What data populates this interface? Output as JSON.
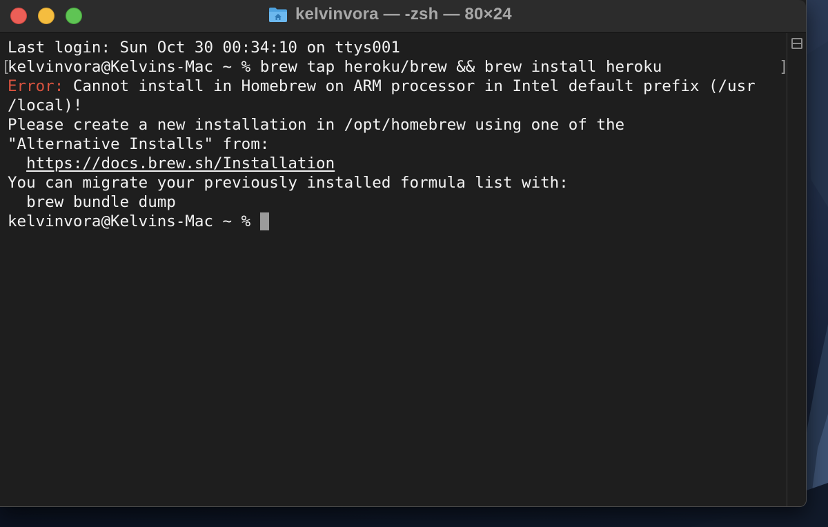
{
  "window": {
    "title": "kelvinvora — -zsh — 80×24",
    "title_icon": "home-folder-icon"
  },
  "terminal": {
    "lines": {
      "l0": "Last login: Sun Oct 30 00:34:10 on ttys001",
      "l1_prompt": "kelvinvora@Kelvins-Mac ~ % ",
      "l1_command": "brew tap heroku/brew && brew install heroku",
      "l2_error_label": "Error:",
      "l2_text": " Cannot install in Homebrew on ARM processor in Intel default prefix (/usr",
      "l3": "/local)!",
      "l4": "Please create a new installation in /opt/homebrew using one of the",
      "l5": "\"Alternative Installs\" from:",
      "l6_indent": "  ",
      "l6_link": "https://docs.brew.sh/Installation",
      "l7": "You can migrate your previously installed formula list with:",
      "l8": "  brew bundle dump",
      "l9_prompt": "kelvinvora@Kelvins-Mac ~ % "
    },
    "mark_brackets": {
      "left": "[",
      "right": "]"
    }
  },
  "colors": {
    "background": "#1e1e1e",
    "foreground": "#f2f2f2",
    "error": "#d9533f",
    "cursor": "#9b9b9b",
    "titlebar": "#2c2c2c",
    "close": "#ec5f57",
    "minimize": "#f5bd3f",
    "zoom": "#5fc454"
  }
}
